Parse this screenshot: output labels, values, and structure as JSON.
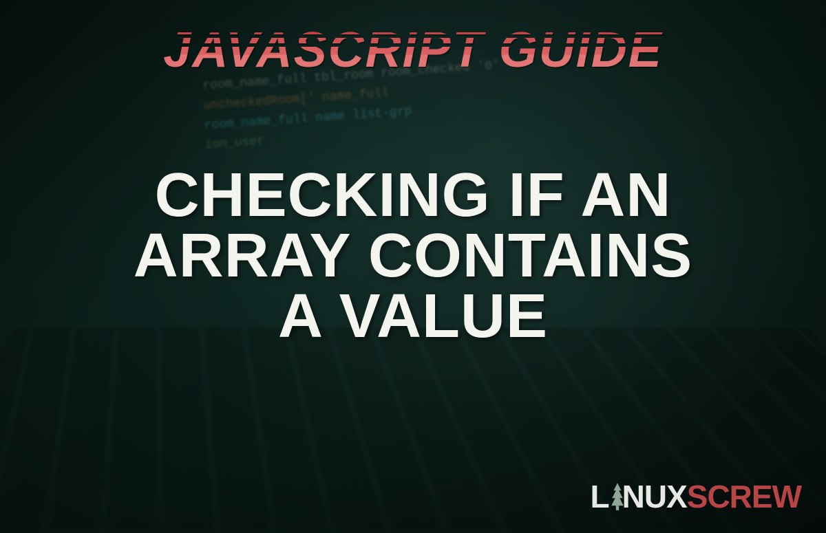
{
  "header": {
    "category": "JAVASCRIPT GUIDE"
  },
  "main": {
    "title_line1": "CHECKING IF AN",
    "title_line2": "ARRAY CONTAINS",
    "title_line3": "A VALUE"
  },
  "logo": {
    "prefix": "L",
    "middle": "NUX",
    "suffix": "SCREW"
  },
  "background_code": {
    "line1": "room_name_full tbl_room room_checked '0'",
    "line2": "uncheckedRoom[' name_full",
    "line3": "room_name_full    name   list-grp",
    "line4": "ion_user"
  }
}
